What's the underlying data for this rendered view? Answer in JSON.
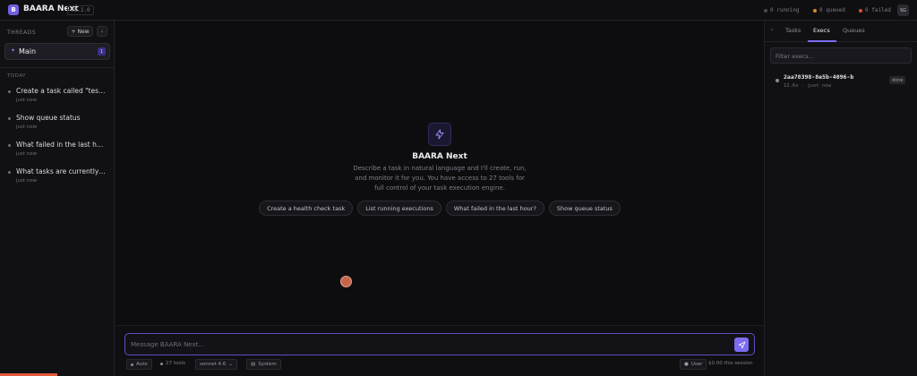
{
  "app": {
    "logo_letter": "B",
    "title": "BAARA Next",
    "version": "v0.1.0"
  },
  "status": {
    "running": "0 running",
    "queued": "0 queued",
    "failed": "0 failed",
    "colors": {
      "running": "#4a4a55",
      "queued": "#d98a2b",
      "failed": "#d9532b"
    }
  },
  "user": {
    "initials": "SG"
  },
  "sidebar": {
    "threads_label": "THREADS",
    "new_label": "New",
    "collapse_glyph": "‹",
    "main_thread": {
      "label": "Main",
      "badge": "1"
    },
    "today_label": "TODAY",
    "threads": [
      {
        "title": "Create a task called \"test-ping\" that runs",
        "time": "just now"
      },
      {
        "title": "Show queue status",
        "time": "just now"
      },
      {
        "title": "What failed in the last hour?",
        "time": "just now"
      },
      {
        "title": "What tasks are currently running?",
        "time": "just now"
      }
    ]
  },
  "hero": {
    "title": "BAARA Next",
    "description": "Describe a task in natural language and I'll create, run, and monitor it for you. You have access to 27 tools for full control of your task execution engine.",
    "suggestions": [
      "Create a health check task",
      "List running executions",
      "What failed in the last hour?",
      "Show queue status"
    ]
  },
  "composer": {
    "placeholder": "Message BAARA Next...",
    "mode": "Auto",
    "tools": "27 tools",
    "model": "sonnet 4.6",
    "system": "System",
    "user_btn": "User",
    "cost": "$0.00 this session"
  },
  "rpanel": {
    "collapse_glyph": "‹",
    "tabs": [
      "Tasks",
      "Execs",
      "Queues"
    ],
    "active_tab": "Execs",
    "filter_placeholder": "Filter execs...",
    "executions": [
      {
        "id": "2aa78398-8e5b-4096-b",
        "meta": "12.6s · just now",
        "status": "done"
      }
    ]
  },
  "colors": {
    "accent": "#7b6cf0",
    "progress": "#e25a3a"
  }
}
